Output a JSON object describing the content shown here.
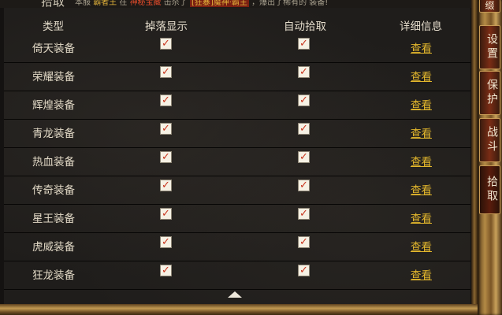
{
  "window": {
    "title": "拾取",
    "news": {
      "part1": "本服",
      "name1": "霸者王",
      "part2": "在",
      "location": "神秘宝藏",
      "part3": "击杀了",
      "boss": "[狂暴]魔神·霸主",
      "part4": "，爆出了稀有的",
      "tail": "装备!"
    }
  },
  "table": {
    "headers": {
      "type": "类型",
      "drop_display": "掉落显示",
      "auto_pickup": "自动拾取",
      "details": "详细信息"
    },
    "rows": [
      {
        "name": "倚天装备",
        "drop_display": true,
        "auto_pickup": true,
        "details": "查看"
      },
      {
        "name": "荣耀装备",
        "drop_display": true,
        "auto_pickup": true,
        "details": "查看"
      },
      {
        "name": "辉煌装备",
        "drop_display": true,
        "auto_pickup": true,
        "details": "查看"
      },
      {
        "name": "青龙装备",
        "drop_display": true,
        "auto_pickup": true,
        "details": "查看"
      },
      {
        "name": "热血装备",
        "drop_display": true,
        "auto_pickup": true,
        "details": "查看"
      },
      {
        "name": "传奇装备",
        "drop_display": true,
        "auto_pickup": true,
        "details": "查看"
      },
      {
        "name": "星王装备",
        "drop_display": true,
        "auto_pickup": true,
        "details": "查看"
      },
      {
        "name": "虎威装备",
        "drop_display": true,
        "auto_pickup": true,
        "details": "查看"
      },
      {
        "name": "狂龙装备",
        "drop_display": true,
        "auto_pickup": true,
        "details": "查看"
      }
    ]
  },
  "side_tabs": {
    "top": "缀",
    "settings": "设置",
    "protect": "保护",
    "combat": "战斗",
    "pickup": "拾取"
  },
  "icons": {
    "close": "close-icon",
    "check": "check-icon",
    "scroll_up": "triangle-up-icon"
  },
  "colors": {
    "link": "#e2b62c",
    "check_mark": "#c8341d",
    "frame_gold": "#b48a45",
    "tab_red": "#7a2c15"
  }
}
